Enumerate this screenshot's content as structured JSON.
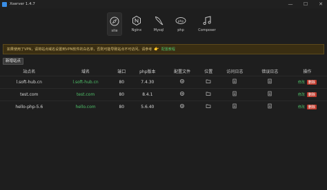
{
  "window": {
    "title": "Xserver 1.4.7",
    "minimize": "—",
    "maximize": "☐",
    "close": "✕"
  },
  "nav": [
    {
      "label": "site",
      "icon": "compass-icon",
      "active": true
    },
    {
      "label": "Nginx",
      "icon": "nginx-icon",
      "active": false
    },
    {
      "label": "Mysql",
      "icon": "dolphin-icon",
      "active": false
    },
    {
      "label": "php",
      "icon": "php-icon",
      "active": false
    },
    {
      "label": "Composer",
      "icon": "music-note-icon",
      "active": false
    }
  ],
  "notice": {
    "text": "如果使用了VPN，请将站点域名设置到VPN软件的白名单，否则可能导致站点不可访问。请参考",
    "link": "配置教程"
  },
  "add_button": "新增站点",
  "table": {
    "headers": [
      "站点名",
      "域名",
      "端口",
      "php版本",
      "配置文件",
      "位置",
      "访问日志",
      "错误日志",
      "操作"
    ],
    "rows": [
      {
        "name": "l.soft-hub.cn",
        "domain": "l.soft-hub.cn",
        "port": "80",
        "php": "7.4.30",
        "edit": "修改",
        "del": "删除"
      },
      {
        "name": "test.com",
        "domain": "test.com",
        "port": "80",
        "php": "8.4.1",
        "edit": "修改",
        "del": "删除"
      },
      {
        "name": "hello-php-5.6",
        "domain": "hello.com",
        "port": "80",
        "php": "5.6.40",
        "edit": "修改",
        "del": "删除"
      }
    ]
  }
}
